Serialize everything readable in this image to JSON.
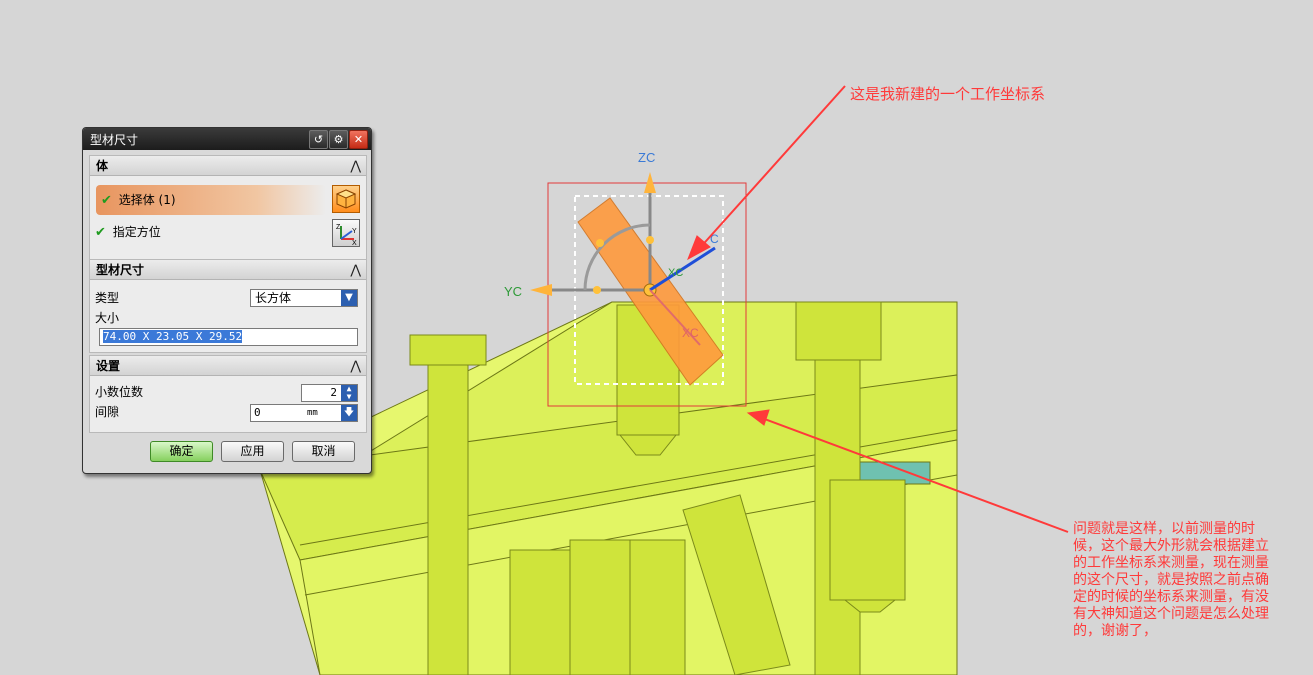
{
  "dialog": {
    "title": "型材尺寸",
    "section_body": {
      "title": "体",
      "select_body_label": "选择体 (1)",
      "specify_orientation_label": "指定方位"
    },
    "section_size": {
      "title": "型材尺寸",
      "type_label": "类型",
      "type_value": "长方体",
      "size_label": "大小",
      "size_value": "74.00 X 23.05 X 29.52"
    },
    "section_settings": {
      "title": "设置",
      "decimal_label": "小数位数",
      "decimal_value": "2",
      "gap_label": "间隙",
      "gap_value": "0",
      "gap_unit": "mm"
    },
    "buttons": {
      "ok": "确定",
      "apply": "应用",
      "cancel": "取消"
    }
  },
  "csys": {
    "zc": "ZC",
    "yc": "YC",
    "xc": "XC",
    "xc_near": "XC",
    "c_fragment": "C"
  },
  "annotations": {
    "top": "这是我新建的一个工作坐标系",
    "bottom_lines": [
      "问题就是这样，以前测量的时",
      "候，这个最大外形就会根据建立",
      "的工作坐标系来测量，现在测量",
      "的这个尺寸，就是按照之前点确",
      "定的时候的坐标系来测量，有没",
      "有大神知道这个问题是怎么处理",
      "的，谢谢了，"
    ]
  },
  "colors": {
    "annotation": "#ff3a3a",
    "model_fill": "#e4f56d",
    "model_edge": "#6f7a16",
    "box": "#ff9a3d"
  }
}
